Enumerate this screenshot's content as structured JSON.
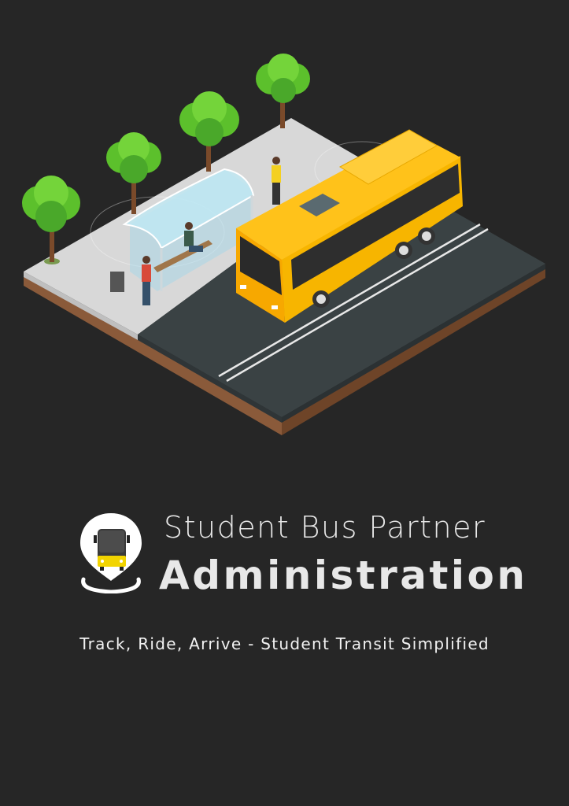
{
  "app": {
    "title_line1": "Student Bus Partner",
    "title_line2": "Administration",
    "tagline": "Track, Ride, Arrive - Student Transit Simplified"
  },
  "illustration": {
    "subject": "bus-stop-isometric-illustration"
  },
  "logo": {
    "icon": "bus-location-pin-icon"
  },
  "colors": {
    "background": "#262626",
    "text": "#e8e8e8",
    "bus_yellow": "#f7b500",
    "road": "#3a4244",
    "sidewalk": "#d9d9d9"
  }
}
